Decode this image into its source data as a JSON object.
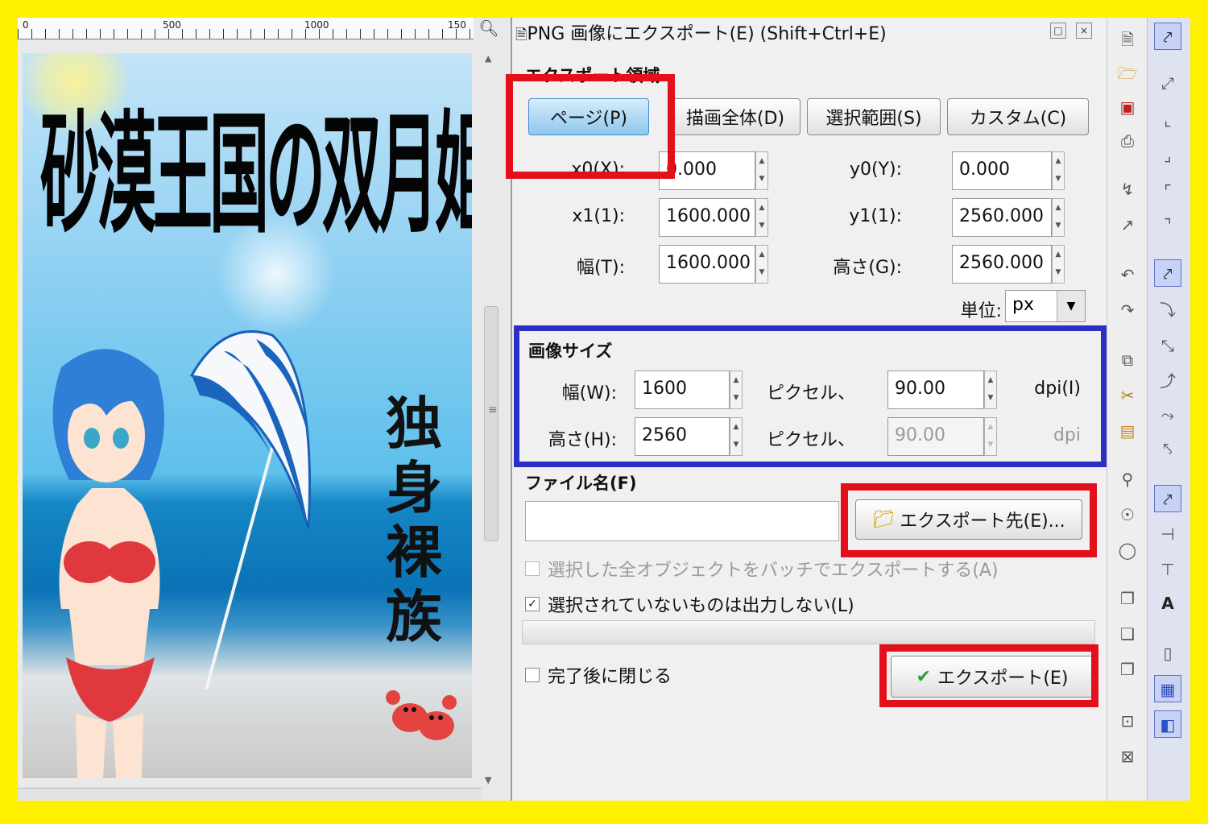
{
  "canvas": {
    "ruler_labels": [
      "0",
      "500",
      "1000",
      "150"
    ],
    "zoom_icon": "zoom-icon",
    "cover": {
      "title": "砂漠王国の双月姫",
      "subtitle_chars": [
        "独",
        "身",
        "裸",
        "族"
      ]
    }
  },
  "dialog": {
    "title": "PNG 画像にエクスポート(E) (Shift+Ctrl+E)",
    "area_section": "エクスポート領域",
    "area_buttons": [
      "ページ(P)",
      "描画全体(D)",
      "選択範囲(S)",
      "カスタム(C)"
    ],
    "active_area": "ページ(P)",
    "coords": {
      "x0_label": "x0(X):",
      "x0": "0.000",
      "y0_label": "y0(Y):",
      "y0": "0.000",
      "x1_label": "x1(1):",
      "x1": "1600.000",
      "y1_label": "y1(1):",
      "y1": "2560.000",
      "width_label": "幅(T):",
      "width": "1600.000",
      "height_label": "高さ(G):",
      "height": "2560.000"
    },
    "unit_label": "単位:",
    "unit_value": "px",
    "image_size_section": "画像サイズ",
    "image_size": {
      "width_label": "幅(W):",
      "width": "1600",
      "pixel_label_1": "ピクセル、",
      "dpi_value": "90.00",
      "dpi_label": "dpi(I)",
      "height_label": "高さ(H):",
      "height": "2560",
      "pixel_label_2": "ピクセル、",
      "dpi_value_2": "90.00",
      "dpi_label_2": "dpi"
    },
    "filename_section": "ファイル名(F)",
    "filename_value": "",
    "export_to_button": "エクスポート先(E)...",
    "batch_checkbox": "選択した全オブジェクトをバッチでエクスポートする(A)",
    "hide_unselected_checkbox": "選択されていないものは出力しない(L)",
    "hide_unselected_checked": true,
    "close_when_done_checkbox": "完了後に閉じる",
    "export_button": "エクスポート(E)"
  },
  "colors": {
    "highlight_red": "#e3101c",
    "highlight_blue": "#2b2fc4",
    "screenshot_border": "#fff000"
  }
}
